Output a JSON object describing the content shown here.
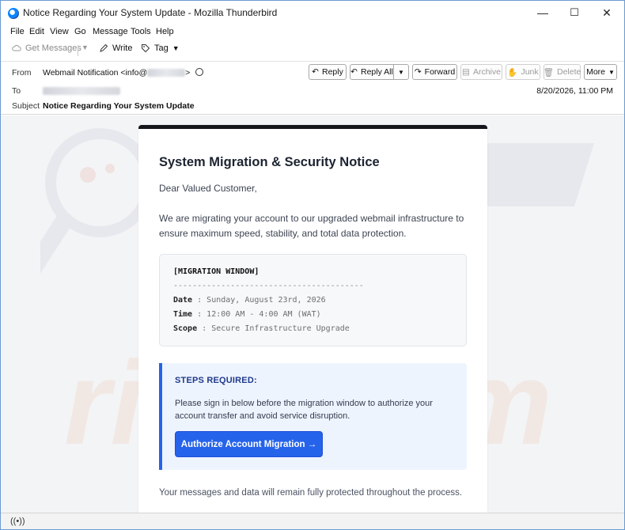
{
  "window": {
    "title": "Notice Regarding Your System Update - Mozilla Thunderbird",
    "controls": {
      "minimize": "—",
      "maximize": "☐",
      "close": "✕"
    }
  },
  "menubar": {
    "items": [
      {
        "label": "File"
      },
      {
        "label": "Edit"
      },
      {
        "label": "View"
      },
      {
        "label": "Go"
      },
      {
        "label": "Message"
      },
      {
        "label": "Tools"
      },
      {
        "label": "Help"
      }
    ]
  },
  "toolbar": {
    "get_messages": "Get Messages",
    "write": "Write",
    "tag": "Tag"
  },
  "header": {
    "from_label": "From",
    "from_value_prefix": "Webmail Notification <info@",
    "from_value_suffix": ">",
    "to_label": "To",
    "subject_label": "Subject",
    "subject_value": "Notice Regarding Your System Update",
    "date": "8/20/2026, 11:00 PM",
    "buttons": {
      "reply": "Reply",
      "reply_all": "Reply All",
      "forward": "Forward",
      "archive": "Archive",
      "junk": "Junk",
      "delete": "Delete",
      "more": "More"
    }
  },
  "email": {
    "title": "System Migration & Security Notice",
    "greeting": "Dear Valued Customer,",
    "intro": "We are migrating your account to our upgraded webmail infrastructure to ensure maximum speed, stability, and total data protection.",
    "migration_box": {
      "heading": "[MIGRATION WINDOW]",
      "separator": "----------------------------------------",
      "rows": [
        {
          "key": "Date",
          "value": "Sunday, August 23rd, 2026"
        },
        {
          "key": "Time",
          "value": "12:00 AM - 4:00 AM (WAT)"
        },
        {
          "key": "Scope",
          "value": "Secure Infrastructure Upgrade"
        }
      ]
    },
    "steps": {
      "title": "STEPS REQUIRED:",
      "text": "Please sign in below before the migration window to authorize your account transfer and avoid service disruption.",
      "button": "Authorize Account Migration →"
    },
    "footer": "Your messages and data will remain fully protected throughout the process."
  },
  "colors": {
    "accent": "#2563eb",
    "card_top_border": "#14161c",
    "steps_background": "#eef4fe"
  }
}
